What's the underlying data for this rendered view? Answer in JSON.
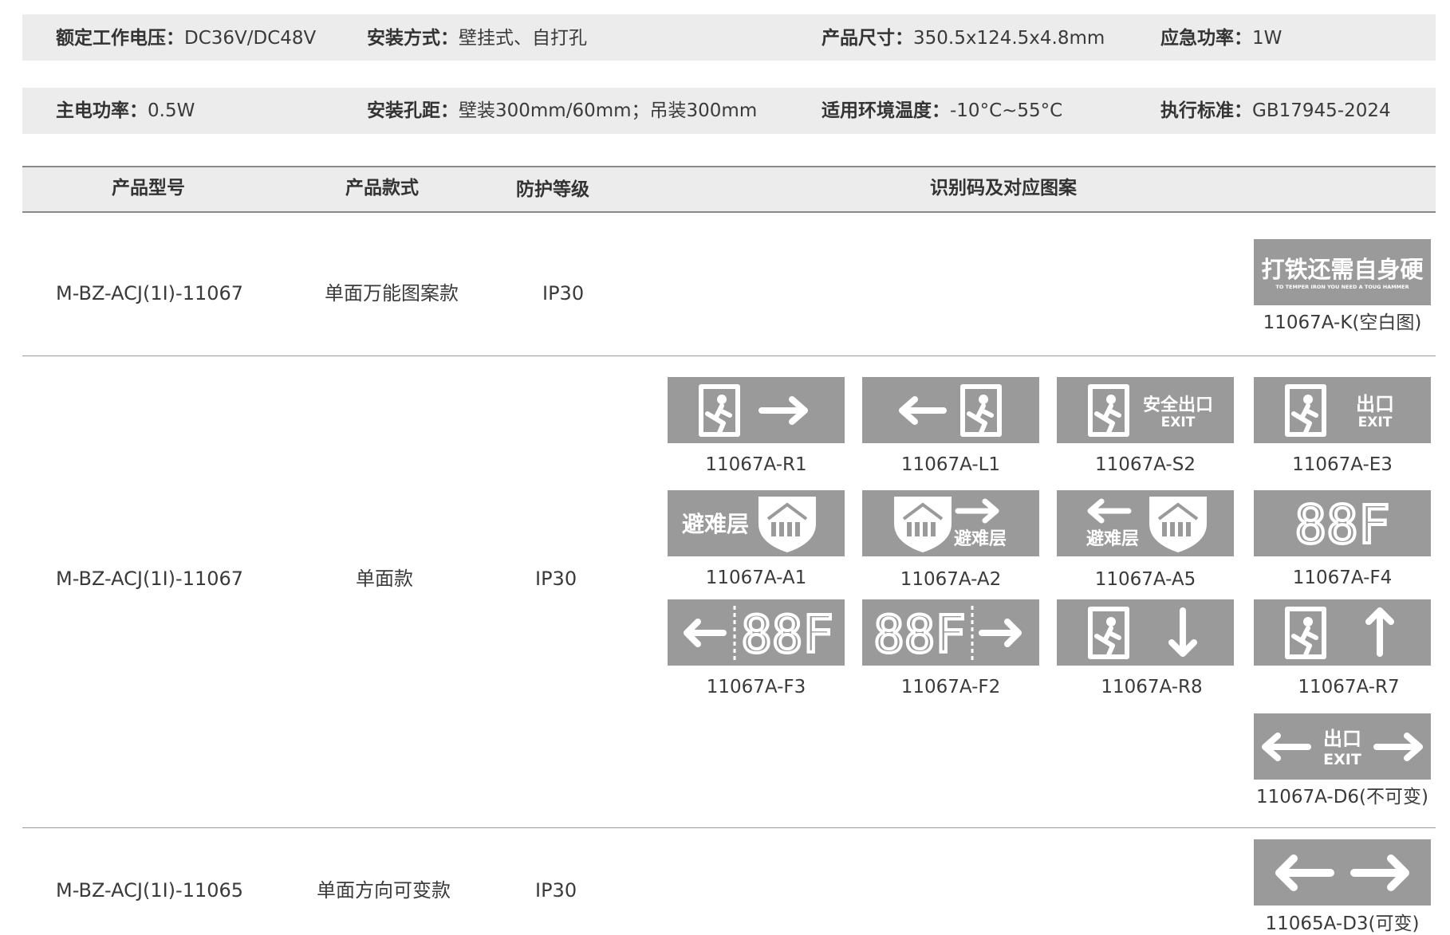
{
  "specs": [
    {
      "label": "额定工作电压：",
      "value": "DC36V/DC48V"
    },
    {
      "label": "安装方式：",
      "value": "壁挂式、自打孔"
    },
    {
      "label": "产品尺寸：",
      "value": "350.5x124.5x4.8mm"
    },
    {
      "label": "应急功率：",
      "value": "1W"
    },
    {
      "label": "主电功率：",
      "value": "0.5W"
    },
    {
      "label": "安装孔距：",
      "value": "壁装300mm/60mm；吊装300mm"
    },
    {
      "label": "适用环境温度：",
      "value": "-10°C~55°C"
    },
    {
      "label": "执行标准：",
      "value": "GB17945-2024"
    }
  ],
  "table": {
    "headers": [
      "产品型号",
      "产品款式",
      "防护等级",
      "识别码及对应图案"
    ],
    "rows": [
      {
        "model": "M-BZ-ACJ(1Ⅰ)-11067",
        "style": "单面万能图案款",
        "ip": "IP30"
      },
      {
        "model": "M-BZ-ACJ(1Ⅰ)-11067",
        "style": "单面款",
        "ip": "IP30"
      },
      {
        "model": "M-BZ-ACJ(1Ⅰ)-11065",
        "style": "单面方向可变款",
        "ip": "IP30"
      }
    ]
  },
  "signs": [
    {
      "code": "11067A-K(空白图)",
      "icon": "blank-slogan-sign",
      "text_cn": "打铁还需自身硬",
      "text_en": "TO TEMPER IRON YOU NEED A TOUG HAMMER"
    },
    {
      "code": "11067A-R1",
      "icon": "exit-right-arrow-sign"
    },
    {
      "code": "11067A-L1",
      "icon": "left-arrow-exit-sign"
    },
    {
      "code": "11067A-S2",
      "icon": "safety-exit-sign",
      "text_cn": "安全出口",
      "text_en": "EXIT"
    },
    {
      "code": "11067A-E3",
      "icon": "exit-sign",
      "text_cn": "出口",
      "text_en": "EXIT"
    },
    {
      "code": "11067A-A1",
      "icon": "refuge-floor-sign",
      "text_cn": "避难层"
    },
    {
      "code": "11067A-A2",
      "icon": "refuge-floor-right-sign",
      "text_cn": "避难层"
    },
    {
      "code": "11067A-A5",
      "icon": "refuge-floor-left-sign",
      "text_cn": "避难层"
    },
    {
      "code": "11067A-F4",
      "icon": "floor-number-sign",
      "text_cn": "88F"
    },
    {
      "code": "11067A-F3",
      "icon": "floor-number-left-sign",
      "text_cn": "88F"
    },
    {
      "code": "11067A-F2",
      "icon": "floor-number-right-sign",
      "text_cn": "88F"
    },
    {
      "code": "11067A-R8",
      "icon": "exit-down-arrow-sign"
    },
    {
      "code": "11067A-R7",
      "icon": "exit-up-arrow-sign"
    },
    {
      "code": "11067A-D6(不可变)",
      "icon": "exit-bidirectional-sign",
      "text_cn": "出口",
      "text_en": "EXIT"
    },
    {
      "code": "11065A-D3(可变)",
      "icon": "bidirectional-arrow-sign"
    }
  ],
  "colors": {
    "band": "#ececec",
    "sign": "#9a9a9a",
    "sign_fg": "#ffffff",
    "text": "#3a3a3a"
  }
}
